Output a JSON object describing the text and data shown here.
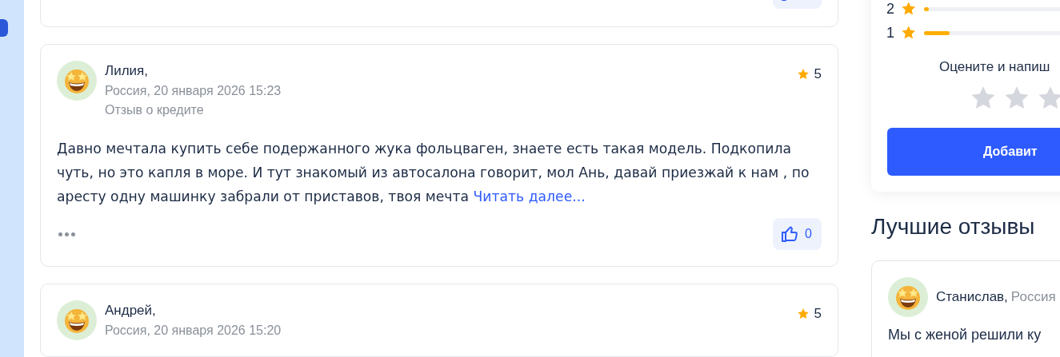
{
  "reviews": [
    {
      "author": "Лилия,",
      "date": "Россия, 20 января 2026 15:23",
      "type": "Отзыв о кредите",
      "rating": "5",
      "text": "Давно мечтала купить себе подержанного жука фольцваген, знаете есть такая модель. Подкопила чуть, но это капля в море. И тут знакомый из автосалона говорит, мол Ань, давай приезжай к нам , по аресту одну машинку забрали от приставов, твоя мечта",
      "more_link": "Читать далее...",
      "likes": "0"
    },
    {
      "author": "Андрей,",
      "date": "Россия, 20 января 2026 15:20",
      "rating": "5"
    }
  ],
  "rating_summary": {
    "rows": [
      {
        "label": "2",
        "level": 0.03
      },
      {
        "label": "1",
        "level": 0.15
      }
    ],
    "prompt": "Оцените и напиш",
    "stars": 0,
    "submit_button": "Добавит"
  },
  "best_reviews": {
    "title": "Лучшие отзывы",
    "items": [
      {
        "author": "Станислав,",
        "location": "Россия",
        "text": "Мы с женой решили ку"
      }
    ]
  }
}
